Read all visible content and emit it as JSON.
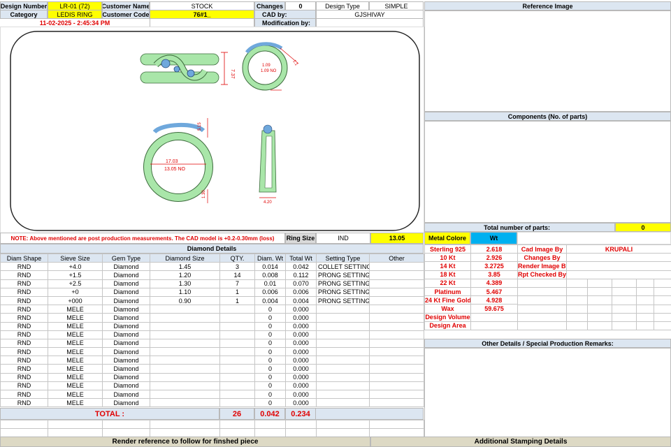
{
  "header": {
    "design_number_label": "Design Number",
    "design_number": "LR-01 (72)",
    "customer_name_label": "Customer Name",
    "customer_name": "STOCK",
    "changes_label": "Changes",
    "changes": "0",
    "design_type_label": "Design Type",
    "design_type": "SIMPLE",
    "category_label": "Category",
    "category": "LEDIS RING",
    "customer_code_label": "Customer Code",
    "customer_code": "76#1_",
    "cad_by_label": "CAD by:",
    "cad_by": "GJSHIVAY",
    "timestamp": "11-02-2025 - 2:45:34 PM",
    "modification_label": "Modification by:",
    "modification": ""
  },
  "render": {
    "dims": [
      "7.37",
      "1.09",
      "1.09 NO",
      "1.1",
      "5.15",
      "17.03",
      "13.05 NO",
      "1.30",
      "4.20"
    ]
  },
  "note": "NOTE: Above mentioned are post production measurements. The CAD model is +0.2-0.30mm (loss)",
  "ring_size": {
    "label": "Ring Size",
    "unit": "IND",
    "value": "13.05"
  },
  "diamond": {
    "title": "Diamond Details",
    "columns": [
      "Diam Shape",
      "Sieve Size",
      "Gem Type",
      "Diamond Size",
      "QTY.",
      "Diam. Wt",
      "Total Wt",
      "Setting Type",
      "Other"
    ],
    "rows": [
      [
        "RND",
        "+4.0",
        "Diamond",
        "1.45",
        "3",
        "0.014",
        "0.042",
        "COLLET SETTING",
        ""
      ],
      [
        "RND",
        "+1.5",
        "Diamond",
        "1.20",
        "14",
        "0.008",
        "0.112",
        "PRONG SETTING",
        ""
      ],
      [
        "RND",
        "+2.5",
        "Diamond",
        "1.30",
        "7",
        "0.01",
        "0.070",
        "PRONG SETTING",
        ""
      ],
      [
        "RND",
        "+0",
        "Diamond",
        "1.10",
        "1",
        "0.006",
        "0.006",
        "PRONG SETTING",
        ""
      ],
      [
        "RND",
        "+000",
        "Diamond",
        "0.90",
        "1",
        "0.004",
        "0.004",
        "PRONG SETTING",
        ""
      ],
      [
        "RND",
        "MELE",
        "Diamond",
        "",
        "",
        "0",
        "0.000",
        "",
        ""
      ],
      [
        "RND",
        "MELE",
        "Diamond",
        "",
        "",
        "0",
        "0.000",
        "",
        ""
      ],
      [
        "RND",
        "MELE",
        "Diamond",
        "",
        "",
        "0",
        "0.000",
        "",
        ""
      ],
      [
        "RND",
        "MELE",
        "Diamond",
        "",
        "",
        "0",
        "0.000",
        "",
        ""
      ],
      [
        "RND",
        "MELE",
        "Diamond",
        "",
        "",
        "0",
        "0.000",
        "",
        ""
      ],
      [
        "RND",
        "MELE",
        "Diamond",
        "",
        "",
        "0",
        "0.000",
        "",
        ""
      ],
      [
        "RND",
        "MELE",
        "Diamond",
        "",
        "",
        "0",
        "0.000",
        "",
        ""
      ],
      [
        "RND",
        "MELE",
        "Diamond",
        "",
        "",
        "0",
        "0.000",
        "",
        ""
      ],
      [
        "RND",
        "MELE",
        "Diamond",
        "",
        "",
        "0",
        "0.000",
        "",
        ""
      ],
      [
        "RND",
        "MELE",
        "Diamond",
        "",
        "",
        "0",
        "0.000",
        "",
        ""
      ],
      [
        "RND",
        "MELE",
        "Diamond",
        "",
        "",
        "0",
        "0.000",
        "",
        ""
      ],
      [
        "RND",
        "MELE",
        "Diamond",
        "",
        "",
        "0",
        "0.000",
        "",
        ""
      ]
    ],
    "total_label": "TOTAL :",
    "total_qty": "26",
    "total_diam_wt": "0.042",
    "total_wt": "0.234"
  },
  "right": {
    "reference_title": "Reference Image",
    "components_title": "Components (No. of parts)",
    "total_parts_label": "Total number of parts:",
    "total_parts": "0",
    "metal_label": "Metal Colore",
    "wt_label": "Wt",
    "metals": [
      {
        "name": "Sterling 925",
        "wt": "2.618"
      },
      {
        "name": "10 Kt",
        "wt": "2.926"
      },
      {
        "name": "14 Kt",
        "wt": "3.2725"
      },
      {
        "name": "18 Kt",
        "wt": "3.85"
      },
      {
        "name": "22 Kt",
        "wt": "4.389"
      },
      {
        "name": "Platinum",
        "wt": "5.467"
      },
      {
        "name": "24 Kt Fine Gold",
        "wt": "4.928"
      },
      {
        "name": "Wax",
        "wt": "59.675"
      },
      {
        "name": "Design Volume",
        "wt": ""
      },
      {
        "name": "Design Area",
        "wt": ""
      }
    ],
    "people": [
      {
        "label": "Cad Image By",
        "value": "KRUPALI"
      },
      {
        "label": "Changes By",
        "value": ""
      },
      {
        "label": "Render Image By",
        "value": ""
      },
      {
        "label": "Rpt Checked By",
        "value": ""
      }
    ],
    "other_title": "Other Details / Special Production Remarks:"
  },
  "footer": {
    "left": "Render reference to follow for finshed piece",
    "right": "Additional Stamping Details"
  },
  "colors": {
    "header": "#dce6f1",
    "yellow": "#ffff00",
    "accent_blue": "#00b0f0",
    "red_text": "#e00000",
    "ring_green": "#a9e6a9"
  }
}
